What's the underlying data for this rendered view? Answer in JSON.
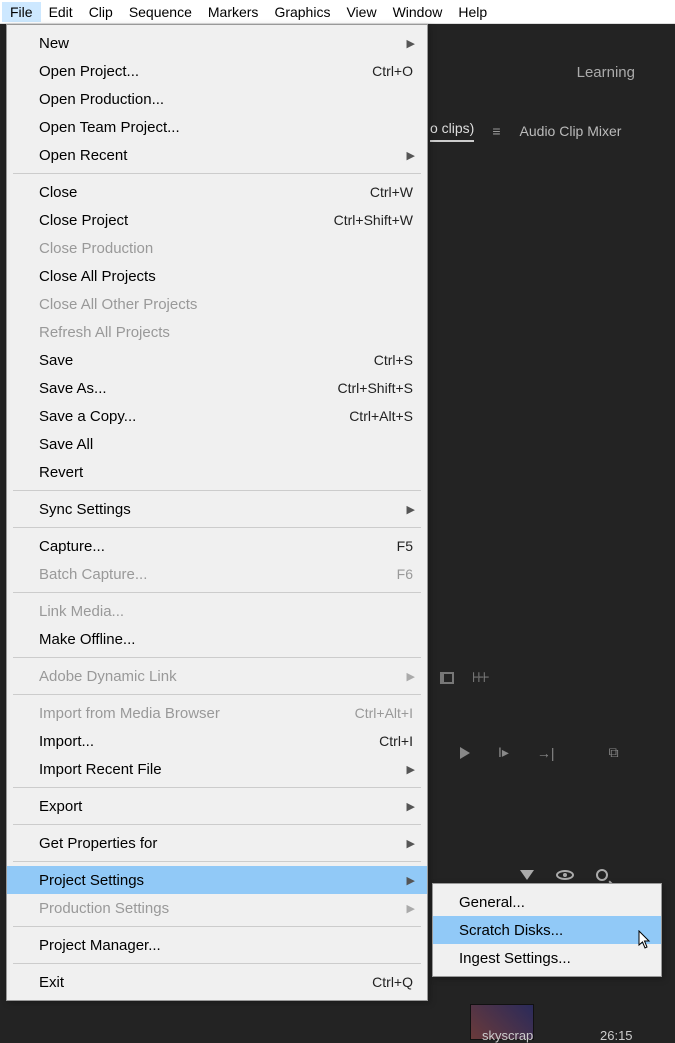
{
  "menubar": {
    "items": [
      "File",
      "Edit",
      "Clip",
      "Sequence",
      "Markers",
      "Graphics",
      "View",
      "Window",
      "Help"
    ],
    "active_index": 0
  },
  "workspace": {
    "tab": "Learning"
  },
  "panel": {
    "right_label": "o clips)",
    "mixer_label": "Audio Clip Mixer"
  },
  "file_menu": [
    {
      "label": "New",
      "submenu": true
    },
    {
      "label": "Open Project...",
      "shortcut": "Ctrl+O"
    },
    {
      "label": "Open Production..."
    },
    {
      "label": "Open Team Project..."
    },
    {
      "label": "Open Recent",
      "submenu": true
    },
    {
      "sep": true
    },
    {
      "label": "Close",
      "shortcut": "Ctrl+W"
    },
    {
      "label": "Close Project",
      "shortcut": "Ctrl+Shift+W"
    },
    {
      "label": "Close Production",
      "disabled": true
    },
    {
      "label": "Close All Projects"
    },
    {
      "label": "Close All Other Projects",
      "disabled": true
    },
    {
      "label": "Refresh All Projects",
      "disabled": true
    },
    {
      "label": "Save",
      "shortcut": "Ctrl+S"
    },
    {
      "label": "Save As...",
      "shortcut": "Ctrl+Shift+S"
    },
    {
      "label": "Save a Copy...",
      "shortcut": "Ctrl+Alt+S"
    },
    {
      "label": "Save All"
    },
    {
      "label": "Revert"
    },
    {
      "sep": true
    },
    {
      "label": "Sync Settings",
      "submenu": true
    },
    {
      "sep": true
    },
    {
      "label": "Capture...",
      "shortcut": "F5"
    },
    {
      "label": "Batch Capture...",
      "shortcut": "F6",
      "disabled": true
    },
    {
      "sep": true
    },
    {
      "label": "Link Media...",
      "disabled": true
    },
    {
      "label": "Make Offline..."
    },
    {
      "sep": true
    },
    {
      "label": "Adobe Dynamic Link",
      "submenu": true,
      "disabled": true
    },
    {
      "sep": true
    },
    {
      "label": "Import from Media Browser",
      "shortcut": "Ctrl+Alt+I",
      "disabled": true
    },
    {
      "label": "Import...",
      "shortcut": "Ctrl+I"
    },
    {
      "label": "Import Recent File",
      "submenu": true
    },
    {
      "sep": true
    },
    {
      "label": "Export",
      "submenu": true
    },
    {
      "sep": true
    },
    {
      "label": "Get Properties for",
      "submenu": true
    },
    {
      "sep": true
    },
    {
      "label": "Project Settings",
      "submenu": true,
      "hovered": true
    },
    {
      "label": "Production Settings",
      "submenu": true,
      "disabled": true
    },
    {
      "sep": true
    },
    {
      "label": "Project Manager..."
    },
    {
      "sep": true
    },
    {
      "label": "Exit",
      "shortcut": "Ctrl+Q"
    }
  ],
  "submenu": {
    "items": [
      {
        "label": "General..."
      },
      {
        "label": "Scratch Disks...",
        "hovered": true
      },
      {
        "label": "Ingest Settings..."
      }
    ]
  },
  "bin": {
    "thumb_label": "skyscrap",
    "thumb_time": "26:15"
  }
}
